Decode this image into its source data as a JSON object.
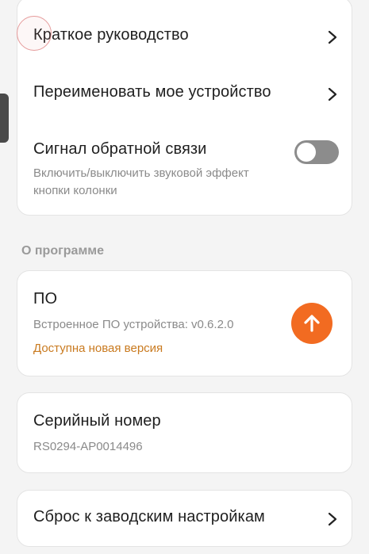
{
  "settings": {
    "quick_guide": {
      "label": "Краткое руководство"
    },
    "rename_device": {
      "label": "Переименовать мое устройство"
    },
    "feedback_signal": {
      "label": "Сигнал обратной связи",
      "description": "Включить/выключить звуковой эффект кнопки колонки",
      "enabled": false
    }
  },
  "about": {
    "section_title": "О программе",
    "firmware": {
      "title": "ПО",
      "version_text": "Встроенное ПО устройства: v0.6.2.0",
      "update_notice": "Доступна новая версия"
    },
    "serial": {
      "title": "Серийный номер",
      "value": "RS0294-AP0014496"
    },
    "factory_reset": {
      "label": "Сброс к заводским настройкам"
    }
  },
  "icons": {
    "chevron": "chevron-right-icon",
    "update": "arrow-up-icon"
  },
  "colors": {
    "accent": "#f26b21",
    "update_notice": "#c97a1f",
    "toggle_off": "#8c8c8c",
    "card_bg": "#ffffff",
    "page_bg": "#f4f4f4"
  }
}
